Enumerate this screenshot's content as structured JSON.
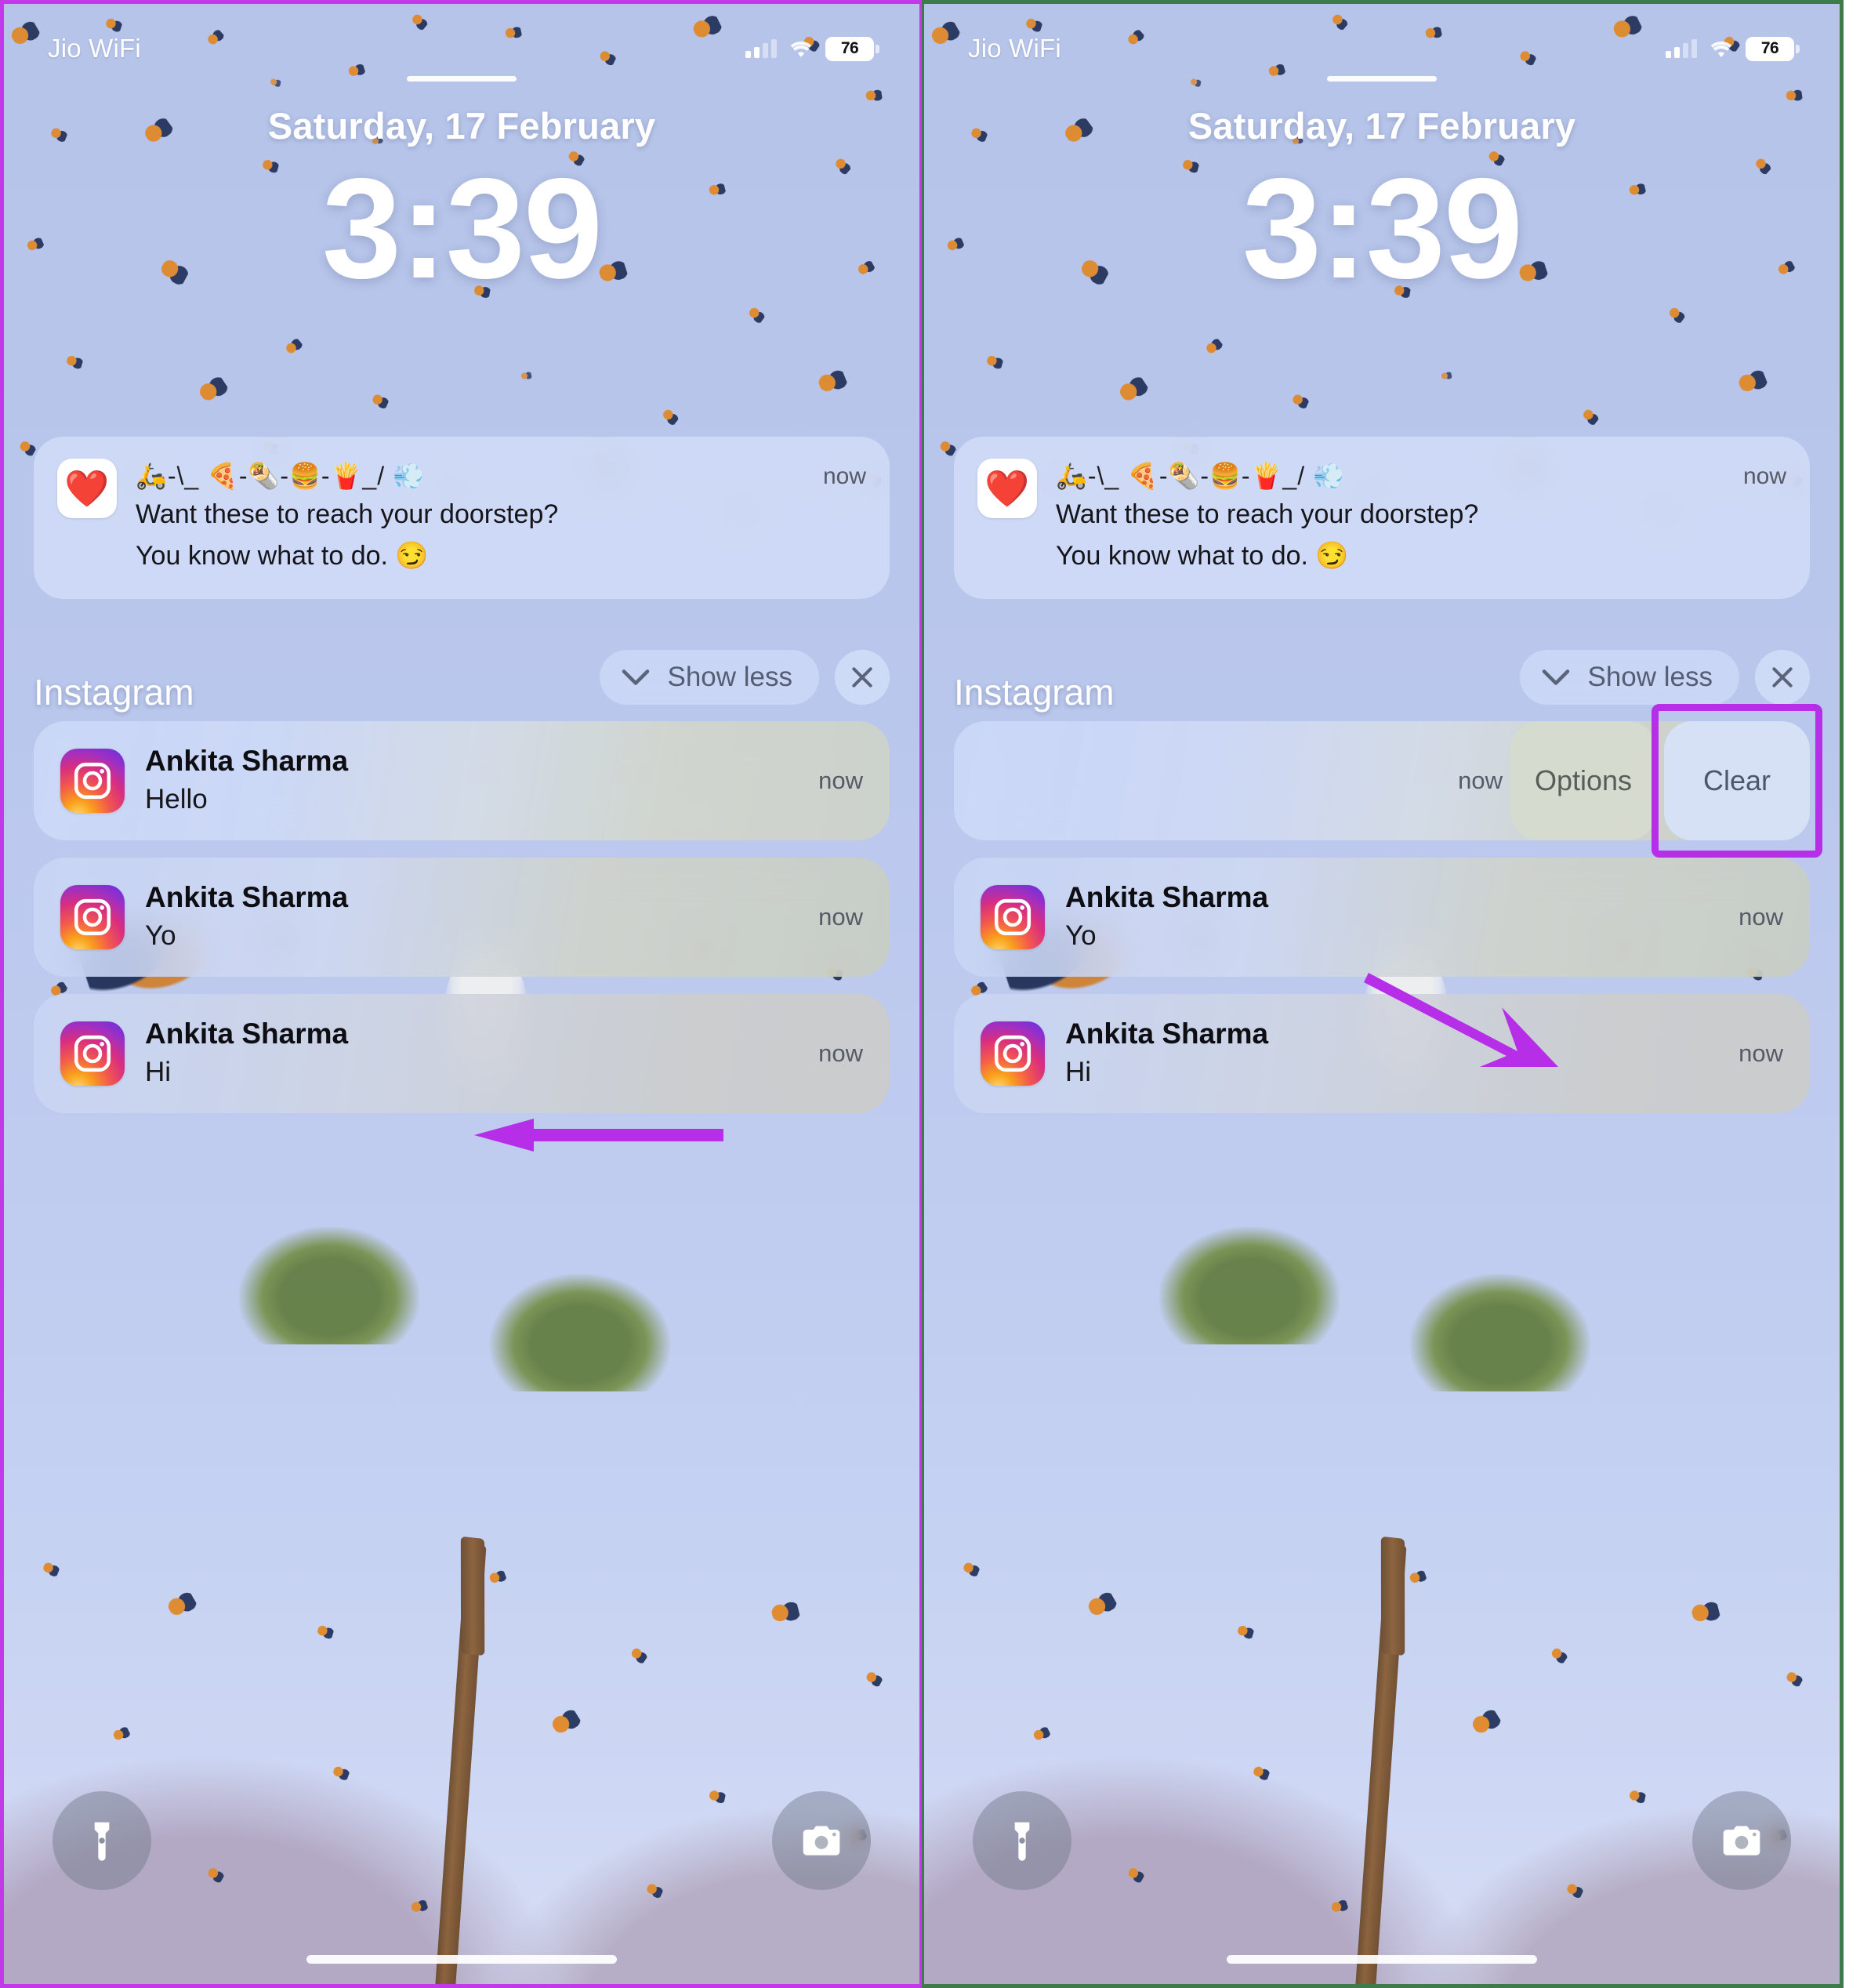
{
  "screenshot": {
    "panels": 2,
    "annotation_color": "#b62ee8",
    "left_panel_border": "#c23ae8",
    "right_panel_border": "#3f7a4a"
  },
  "status_bar": {
    "carrier": "Jio WiFi",
    "signal_icon": "cellular-bars-icon",
    "wifi_icon": "wifi-icon",
    "battery_percent": "76"
  },
  "lock_screen": {
    "date": "Saturday, 17 February",
    "time": "3:39"
  },
  "notifications": {
    "zomato": {
      "app_icon": "zomato-app-icon",
      "emoji_line": "🛵-\\_ 🍕-🌯-🍔-🍟_/ 💨",
      "message_line1": "Want these to reach your doorstep?",
      "message_line2": "You know what to do. 😏",
      "timestamp": "now"
    },
    "group": {
      "title": "Instagram",
      "show_less_label": "Show less",
      "chevron_icon": "chevron-down-icon",
      "close_icon": "close-icon"
    },
    "instagram_items": [
      {
        "app_icon": "instagram-app-icon",
        "sender": "Ankita Sharma",
        "message": "Hello",
        "timestamp": "now"
      },
      {
        "app_icon": "instagram-app-icon",
        "sender": "Ankita Sharma",
        "message": "Yo",
        "timestamp": "now"
      },
      {
        "app_icon": "instagram-app-icon",
        "sender": "Ankita Sharma",
        "message": "Hi",
        "timestamp": "now"
      }
    ]
  },
  "swipe_actions": {
    "options_label": "Options",
    "clear_label": "Clear",
    "timestamp": "now",
    "highlighted_action": "Clear"
  },
  "bottom_controls": {
    "flashlight_icon": "flashlight-icon",
    "camera_icon": "camera-icon",
    "home_indicator": "home-indicator"
  }
}
